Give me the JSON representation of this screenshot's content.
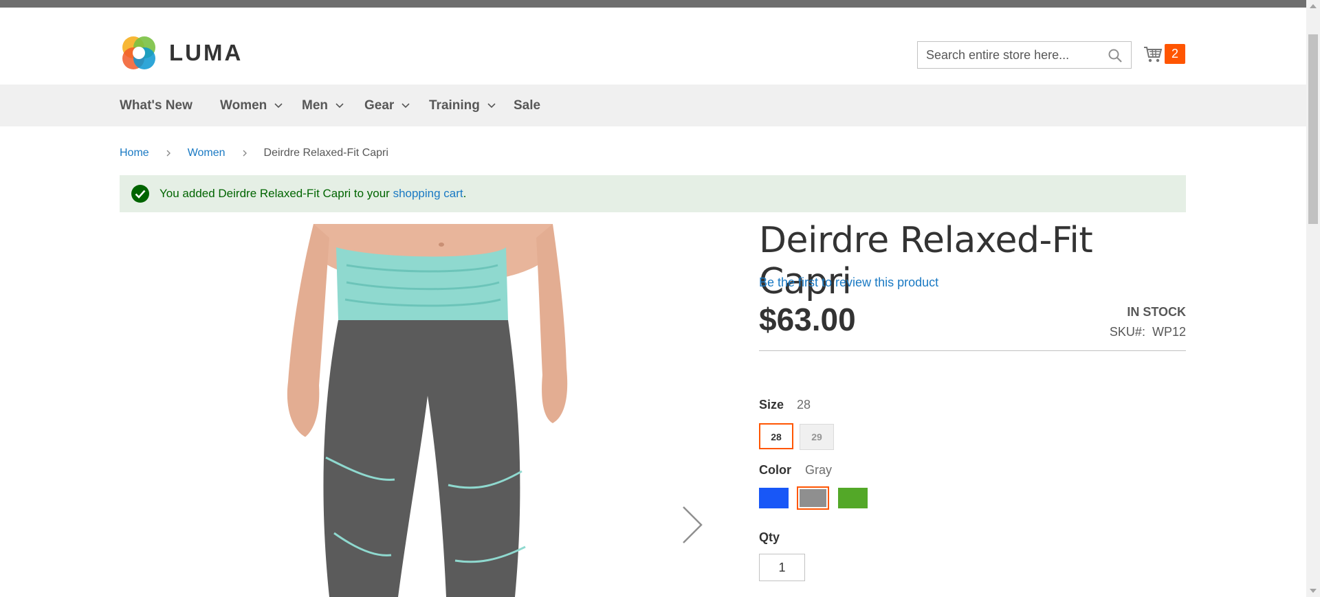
{
  "header": {
    "logo_text": "LUMA",
    "search_placeholder": "Search entire store here...",
    "cart_count": "2"
  },
  "nav": {
    "items": [
      {
        "label": "What's New",
        "has_dropdown": false
      },
      {
        "label": "Women",
        "has_dropdown": true
      },
      {
        "label": "Men",
        "has_dropdown": true
      },
      {
        "label": "Gear",
        "has_dropdown": true
      },
      {
        "label": "Training",
        "has_dropdown": true
      },
      {
        "label": "Sale",
        "has_dropdown": false
      }
    ]
  },
  "breadcrumb": {
    "home": "Home",
    "category": "Women",
    "current": "Deirdre Relaxed-Fit Capri"
  },
  "message": {
    "prefix": "You added Deirdre Relaxed-Fit Capri to your ",
    "link": "shopping cart",
    "suffix": "."
  },
  "product": {
    "title": "Deirdre Relaxed-Fit Capri",
    "review_link": "Be the first to review this product",
    "price": "$63.00",
    "stock": "IN STOCK",
    "sku_label": "SKU#:",
    "sku_value": "WP12",
    "size_label": "Size",
    "size_selected": "28",
    "sizes": [
      "28",
      "29"
    ],
    "color_label": "Color",
    "color_selected": "Gray",
    "colors": [
      {
        "name": "Blue",
        "hex": "#1857f7"
      },
      {
        "name": "Gray",
        "hex": "#8f8f8f"
      },
      {
        "name": "Green",
        "hex": "#53a828"
      }
    ],
    "qty_label": "Qty",
    "qty_value": "1"
  },
  "colors": {
    "accent": "#ff5501",
    "link": "#1979c3",
    "success_bg": "#e5efe5",
    "success_text": "#006400"
  }
}
